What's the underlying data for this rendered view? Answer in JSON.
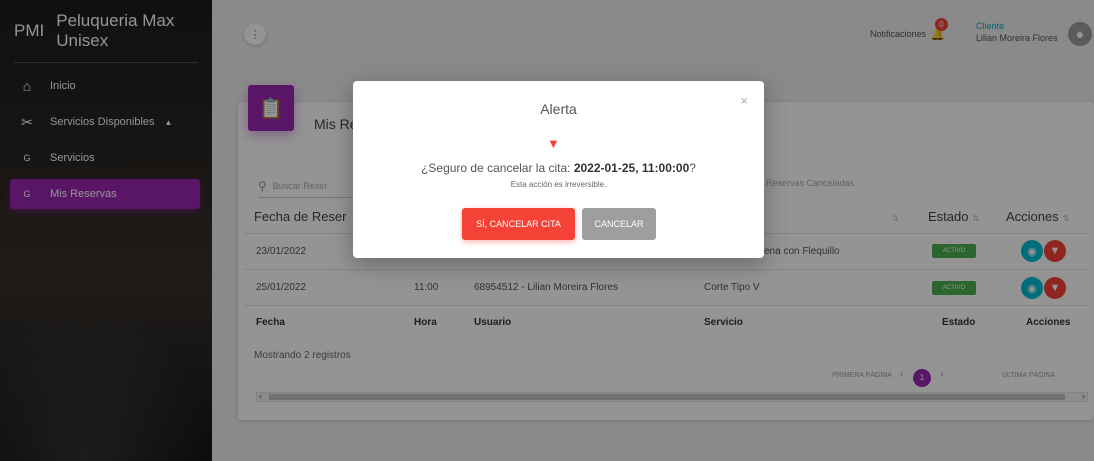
{
  "sidebar": {
    "brand_abbr": "PMI",
    "brand_name": "Peluqueria Max Unisex",
    "items": [
      {
        "label": "Inicio",
        "icon": "home-icon"
      },
      {
        "label": "Servicios Disponibles",
        "icon": "scissors-icon"
      },
      {
        "label": "Servicios",
        "mini": "G"
      },
      {
        "label": "Mis Reservas",
        "mini": "G"
      }
    ]
  },
  "topbar": {
    "notifications_label": "Notificaciones",
    "notifications_count": "0",
    "user_role": "Cliente",
    "user_name": "Lilian Moreira Flores"
  },
  "card": {
    "title": "Mis Re",
    "search_placeholder": "Buscar Reser",
    "cancel_toggle": "Reservas Canceladas",
    "headers": {
      "date": "Fecha de Reser",
      "status": "Estado",
      "actions": "Acciones"
    },
    "rows": [
      {
        "date": "23/01/2022",
        "time": "",
        "user": "",
        "service": "ena con Flequillo",
        "status": "ACTIVO"
      },
      {
        "date": "25/01/2022",
        "time": "11:00",
        "user": "68954512 - Lilian Moreira Flores",
        "service": "Corte Tipo V",
        "status": "ACTIVO"
      }
    ],
    "footer": {
      "date": "Fecha",
      "time": "Hora",
      "user": "Usuario",
      "service": "Servicio",
      "status": "Estado",
      "actions": "Acciones"
    },
    "count": "Mostrando 2 registros",
    "pager": {
      "first": "PRIMERA PÁGINA",
      "page": "1",
      "last": "ÚLTIMA PÁGINA"
    }
  },
  "modal": {
    "title": "Alerta",
    "question": "¿Seguro de cancelar la cita: ",
    "datetime": "2022-01-25, 11:00:00",
    "question_end": "?",
    "subtext": "Esta acción es irreversible.",
    "confirm_label": "SÍ, CANCELAR CITA",
    "cancel_label": "CANCELAR"
  },
  "colors": {
    "accent": "#9c27b0",
    "danger": "#f44336",
    "success": "#4caf50",
    "info": "#00bcd4"
  }
}
